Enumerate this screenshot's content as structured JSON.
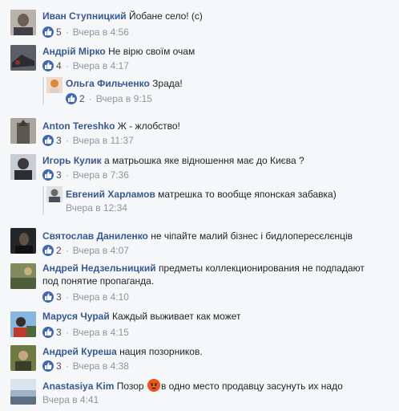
{
  "comments": [
    {
      "author": "Иван Ступницкий",
      "text": "Йобане село! (с)",
      "likes": "5",
      "time": "Вчера в 4:56"
    },
    {
      "author": "Андрій Мірко",
      "text": "Не вірю своїм очам",
      "likes": "4",
      "time": "Вчера в 4:17"
    },
    {
      "author": "Ольга Фильченко",
      "text": "Зрада!",
      "likes": "2",
      "time": "Вчера в 9:15"
    },
    {
      "author": "Anton Tereshko",
      "text": "Ж - жлобство!",
      "likes": "3",
      "time": "Вчера в 11:37"
    },
    {
      "author": "Игорь Кулик",
      "text": "а матрьошка яке відношення має до Києва ?",
      "likes": "3",
      "time": "Вчера в 7:36"
    },
    {
      "author": "Евгений Харламов",
      "text": "матрешка то вообще японская забавка)",
      "likes": "",
      "time": "Вчера в 12:34"
    },
    {
      "author": "Святослав Даниленко",
      "text": "не чіпайте малий бізнес і бидлопересєлєнців",
      "likes": "2",
      "time": "Вчера в 4:07"
    },
    {
      "author": "Андрей Недзельницкий",
      "text": "предметы коллекционирования не подпадают",
      "text2": "под понятие пропаганда.",
      "likes": "3",
      "time": "Вчера в 4:10"
    },
    {
      "author": "Маруся Чурай",
      "text": "Каждый выживает как может",
      "likes": "3",
      "time": "Вчера в 4:15"
    },
    {
      "author": "Андрей Куреша",
      "text": "нация позорников.",
      "likes": "3",
      "time": "Вчера в 4:38"
    },
    {
      "author": "Anastasiya Kim",
      "text": "Позор",
      "text_after": "в одно место продавцу засунуть их надо",
      "likes": "",
      "time": "Вчера в 4:41"
    }
  ],
  "colors": {
    "link": "#365899",
    "like": "#4267b2",
    "meta": "#90949c",
    "emoji": "#e9710f"
  },
  "icons": {
    "like": "thumbs-up-icon",
    "emoji": "angry-face-icon"
  }
}
